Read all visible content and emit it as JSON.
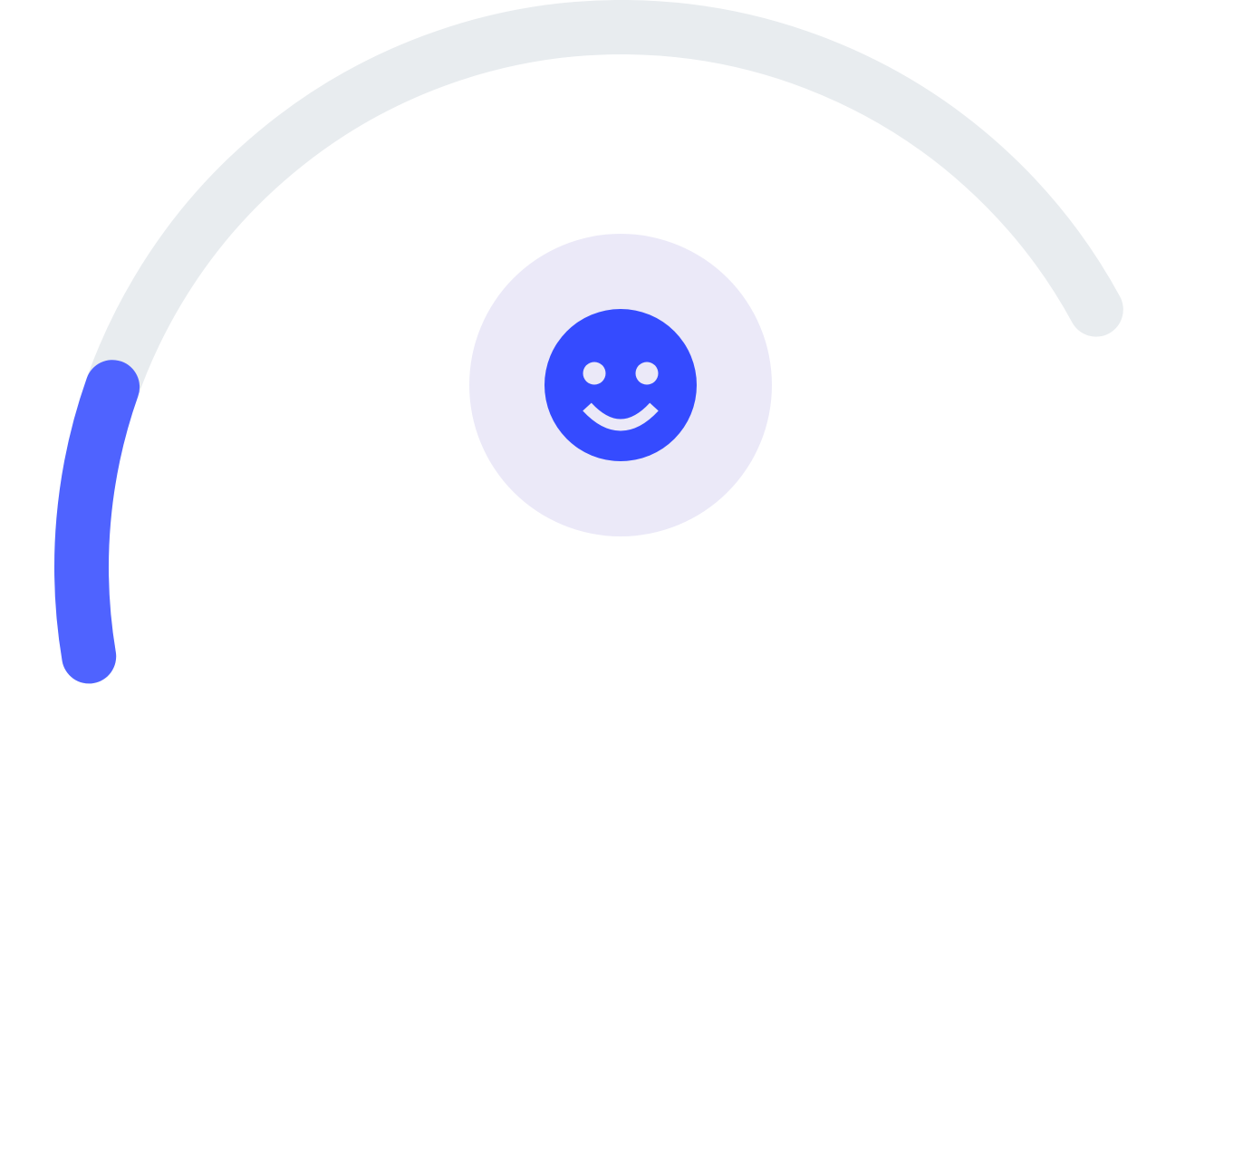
{
  "gauge": {
    "value_fraction": 0.18,
    "track_color": "#e8ecef",
    "fill_color": "#4f63ff"
  },
  "mood": {
    "icon": "smiley-face-icon",
    "badge_color": "#ebe9f8",
    "icon_color": "#354bff"
  }
}
